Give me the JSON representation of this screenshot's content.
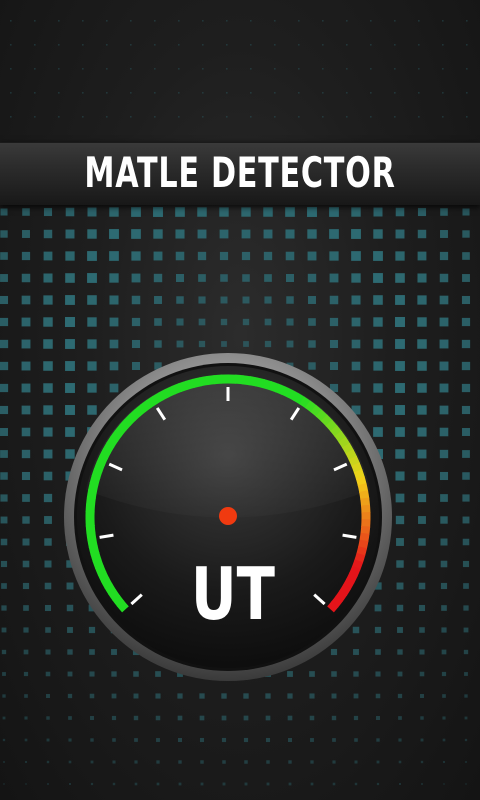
{
  "header": {
    "title": "MATLE DETECTOR"
  },
  "gauge": {
    "unit": "UT",
    "level": 0,
    "tick_count": 9,
    "colors": {
      "low": "#22dd22",
      "mid": "#f2d21a",
      "high": "#e4141a",
      "needle_hub": "#f03a10",
      "dot_pattern": "#2e6b73"
    }
  }
}
